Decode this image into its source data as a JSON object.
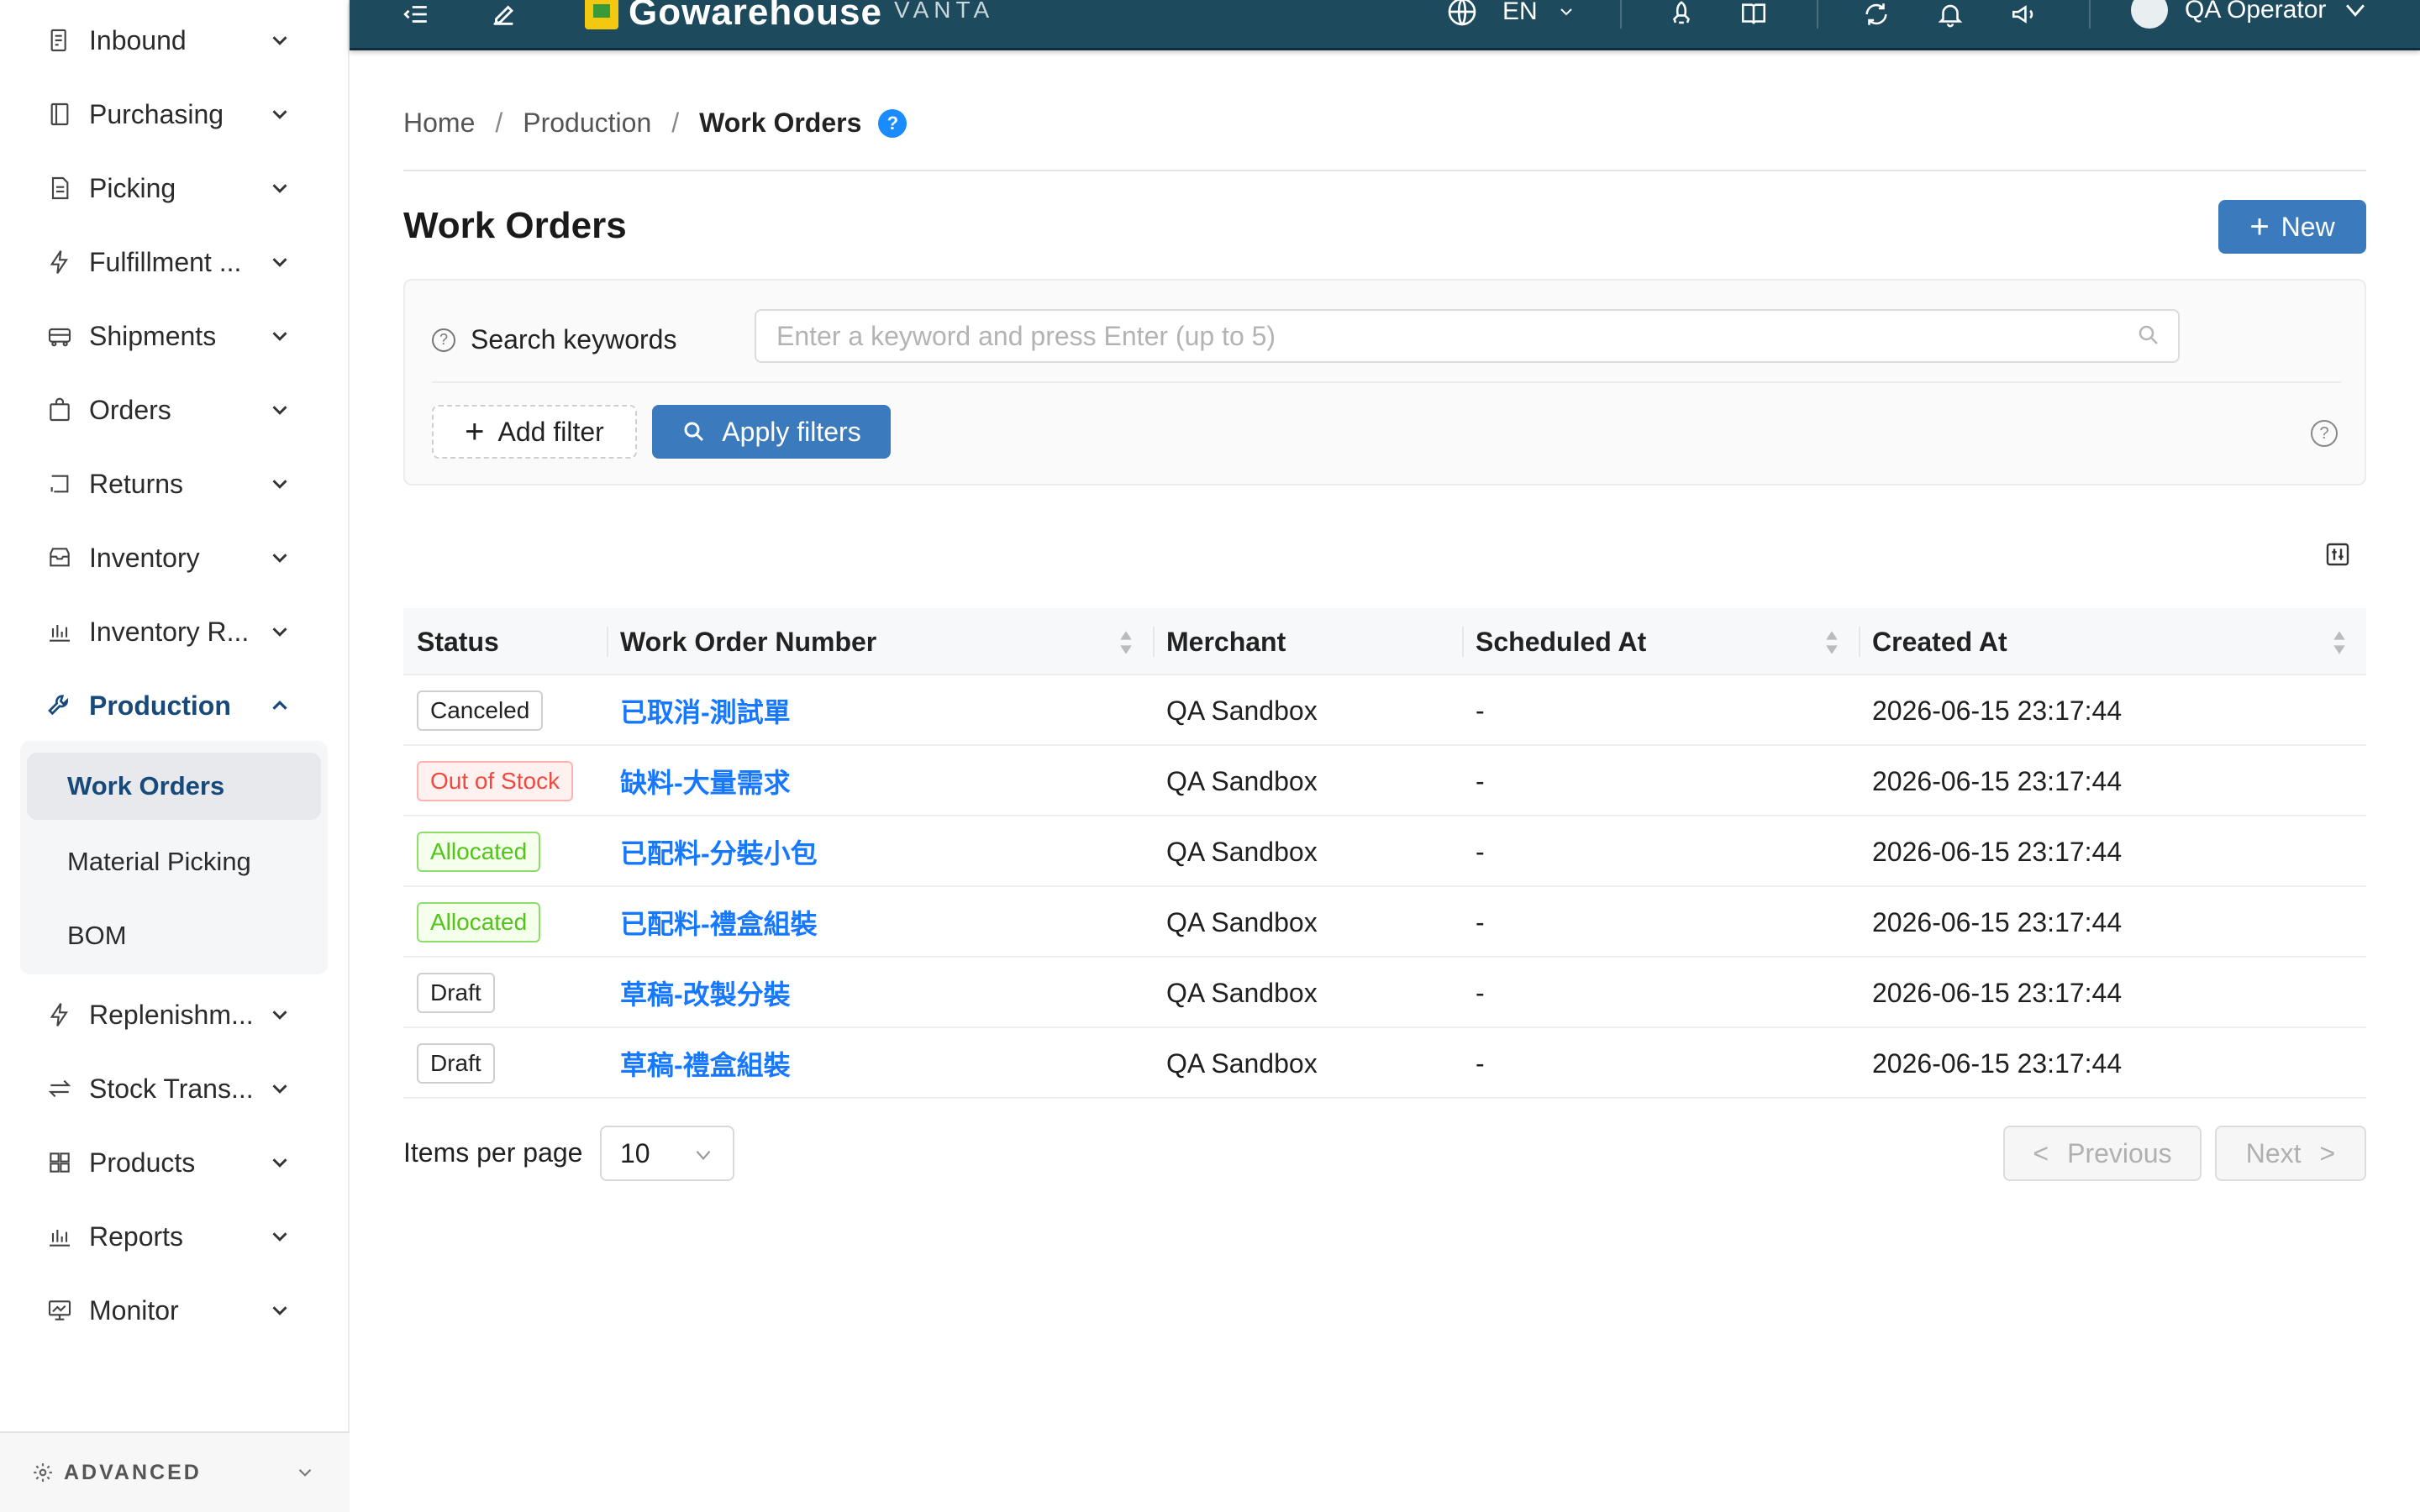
{
  "sidebar": {
    "items": [
      {
        "label": "Inbound",
        "icon": "inbound-icon"
      },
      {
        "label": "Purchasing",
        "icon": "purchasing-icon"
      },
      {
        "label": "Picking",
        "icon": "picking-icon"
      },
      {
        "label": "Fulfillment ...",
        "icon": "lightning-icon"
      },
      {
        "label": "Shipments",
        "icon": "truck-icon"
      },
      {
        "label": "Orders",
        "icon": "bag-icon"
      },
      {
        "label": "Returns",
        "icon": "return-icon"
      },
      {
        "label": "Inventory",
        "icon": "inventory-icon"
      },
      {
        "label": "Inventory R...",
        "icon": "bar-chart-icon"
      },
      {
        "label": "Production",
        "icon": "wrench-icon",
        "active": true
      },
      {
        "label": "Replenishm...",
        "icon": "lightning-icon"
      },
      {
        "label": "Stock Trans...",
        "icon": "transfer-icon"
      },
      {
        "label": "Products",
        "icon": "grid-icon"
      },
      {
        "label": "Reports",
        "icon": "bar-chart-icon"
      },
      {
        "label": "Monitor",
        "icon": "monitor-icon"
      }
    ],
    "submenu": [
      {
        "label": "Work Orders",
        "active": true
      },
      {
        "label": "Material Picking"
      },
      {
        "label": "BOM"
      }
    ],
    "advanced_label": "ADVANCED"
  },
  "header": {
    "logo_text": "Gowarehouse",
    "logo_sub": "VANTA",
    "language": "EN",
    "user_name": "QA Operator"
  },
  "breadcrumb": {
    "home": "Home",
    "section": "Production",
    "current": "Work Orders",
    "help": "?"
  },
  "page": {
    "title": "Work Orders",
    "new_button": "New"
  },
  "filters": {
    "keywords_label": "Search keywords",
    "keywords_placeholder": "Enter a keyword and press Enter (up to 5)",
    "add_filter": "Add filter",
    "apply_filters": "Apply filters"
  },
  "table": {
    "columns": [
      "Status",
      "Work Order Number",
      "Merchant",
      "Scheduled At",
      "Created At"
    ],
    "rows": [
      {
        "status": "Canceled",
        "status_color": "#222222",
        "number": "已取消-測試單",
        "merchant": "QA Sandbox",
        "scheduled": "-",
        "created": "2026-06-15 23:17:44"
      },
      {
        "status": "Out of Stock",
        "status_color": "#f04a3e",
        "number": "缺料-大量需求",
        "merchant": "QA Sandbox",
        "scheduled": "-",
        "created": "2026-06-15 23:17:44"
      },
      {
        "status": "Allocated",
        "status_color": "#52c41a",
        "number": "已配料-分裝小包",
        "merchant": "QA Sandbox",
        "scheduled": "-",
        "created": "2026-06-15 23:17:44"
      },
      {
        "status": "Allocated",
        "status_color": "#52c41a",
        "number": "已配料-禮盒組裝",
        "merchant": "QA Sandbox",
        "scheduled": "-",
        "created": "2026-06-15 23:17:44"
      },
      {
        "status": "Draft",
        "status_color": "#222222",
        "number": "草稿-改製分裝",
        "merchant": "QA Sandbox",
        "scheduled": "-",
        "created": "2026-06-15 23:17:44"
      },
      {
        "status": "Draft",
        "status_color": "#222222",
        "number": "草稿-禮盒組裝",
        "merchant": "QA Sandbox",
        "scheduled": "-",
        "created": "2026-06-15 23:17:44"
      }
    ]
  },
  "pagination": {
    "items_per_page_label": "Items per page",
    "items_per_page_value": "10",
    "previous": "Previous",
    "next": "Next"
  },
  "colors": {
    "accent": "#3b7bbd",
    "header_bg": "#1d4a5c",
    "link": "#1677ff"
  }
}
